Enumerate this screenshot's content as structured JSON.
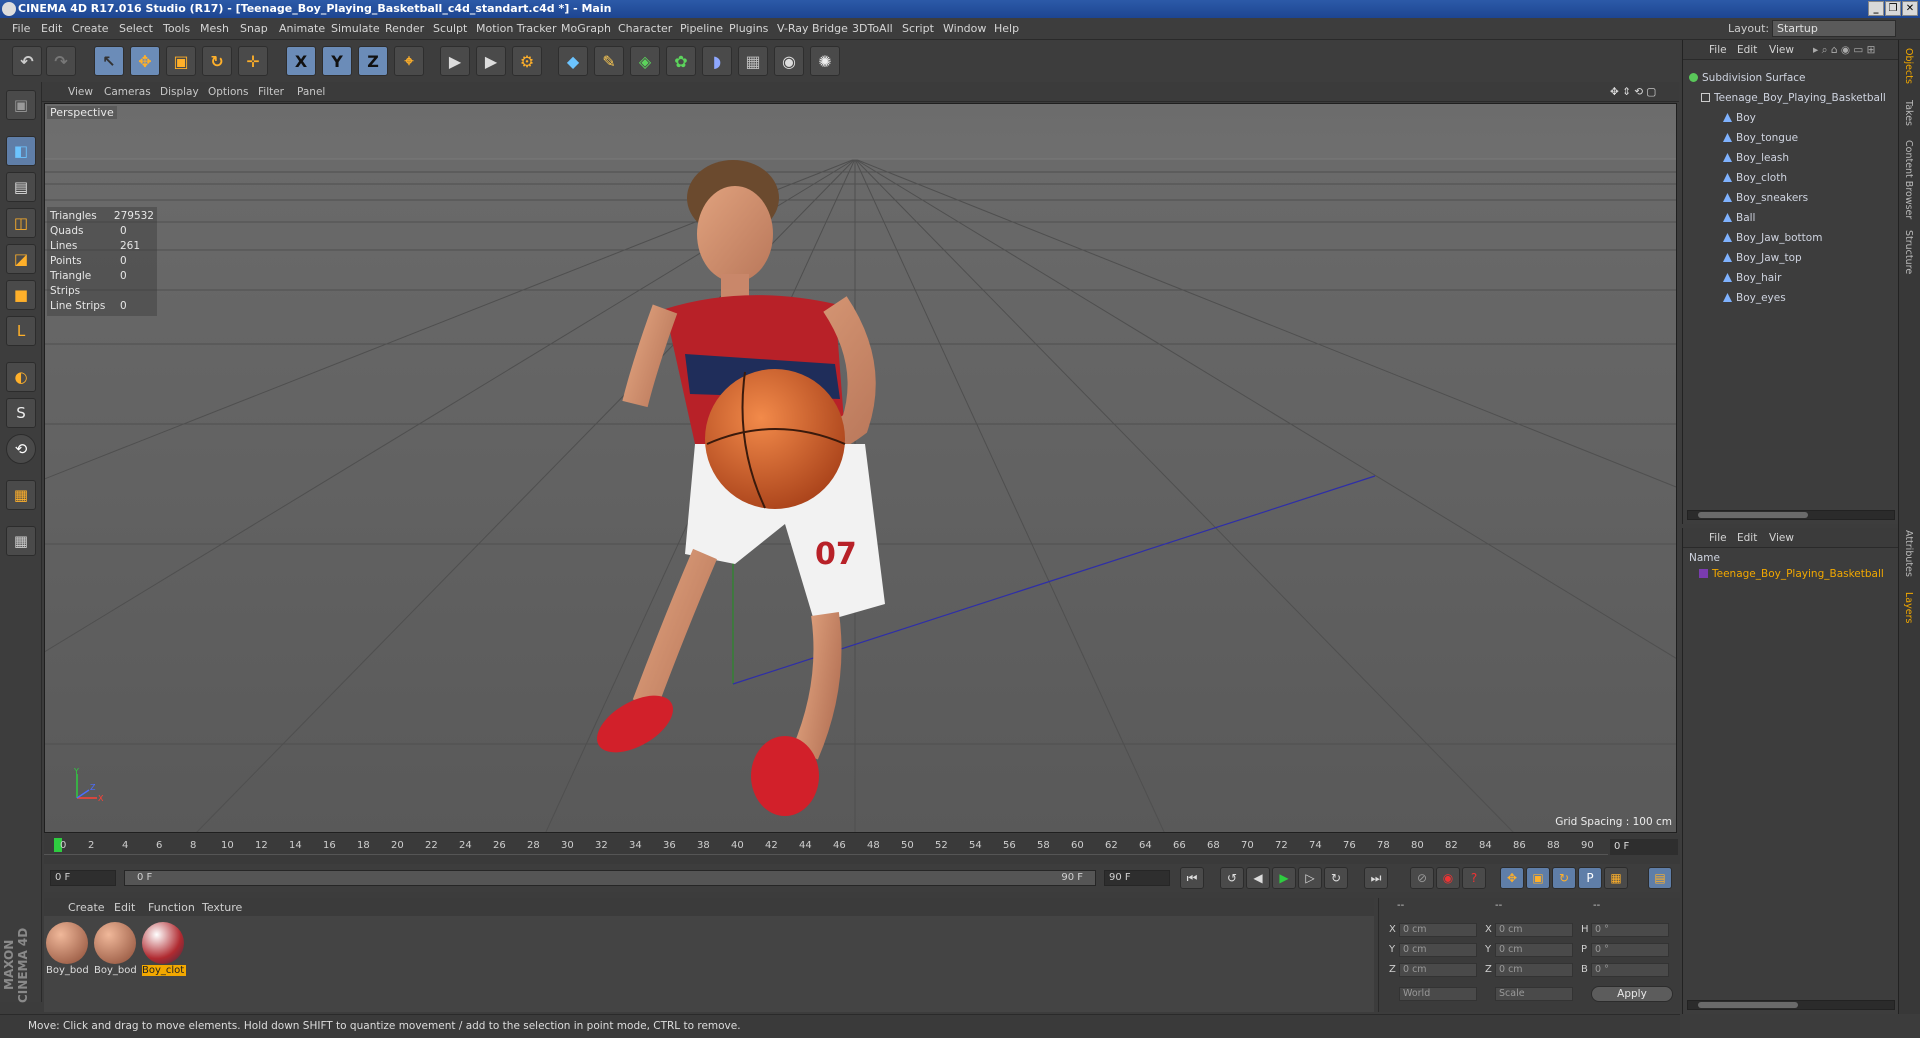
{
  "window": {
    "title": "CINEMA 4D R17.016 Studio (R17) - [Teenage_Boy_Playing_Basketball_c4d_standart.c4d *] - Main",
    "minimize": "_",
    "restore": "❐",
    "close": "✕"
  },
  "menubar": {
    "items": [
      "File",
      "Edit",
      "Create",
      "Select",
      "Tools",
      "Mesh",
      "Snap",
      "Animate",
      "Simulate",
      "Render",
      "Sculpt",
      "Motion Tracker",
      "MoGraph",
      "Character",
      "Pipeline",
      "Plugins",
      "V-Ray Bridge",
      "3DToAll",
      "Script",
      "Window",
      "Help"
    ],
    "layout_label": "Layout:",
    "layout_value": "Startup"
  },
  "toolbar": {
    "undo_icon": "↶",
    "redo_icon": "↷",
    "select_icon": "↖",
    "move_icon": "✥",
    "scale_icon": "▣",
    "rotate_icon": "↻",
    "transform_icon": "✛",
    "x_label": "X",
    "y_label": "Y",
    "z_label": "Z",
    "coord_icon": "⌖",
    "render_view_icon": "▶",
    "render_pic_icon": "▶",
    "render_settings_icon": "⚙",
    "cube_icon": "◆",
    "pen_icon": "✎",
    "subdiv_icon": "◈",
    "array_icon": "✿",
    "deform_icon": "◗",
    "floor_icon": "▦",
    "camera_icon": "◉",
    "light_icon": "✺"
  },
  "left_tools": [
    "▣",
    "◧",
    "▤",
    "◫",
    "◪",
    "■",
    "L",
    "◐",
    "S",
    "⟲",
    "▦",
    "▦"
  ],
  "viewport": {
    "menu": [
      "View",
      "Cameras",
      "Display",
      "Options",
      "Filter",
      "Panel"
    ],
    "camera_label": "Perspective",
    "grid_spacing": "Grid Spacing : 100 cm",
    "stats": [
      {
        "k": "Triangles",
        "v": "279532"
      },
      {
        "k": "Quads",
        "v": "0"
      },
      {
        "k": "Lines",
        "v": "261"
      },
      {
        "k": "Points",
        "v": "0"
      },
      {
        "k": "Triangle Strips",
        "v": "0"
      },
      {
        "k": "Line Strips",
        "v": "0"
      }
    ],
    "jersey_number": "07",
    "axis_y": "Y",
    "axis_x": "X",
    "axis_z": "Z"
  },
  "timeline": {
    "ticks": [
      "0",
      "2",
      "4",
      "6",
      "8",
      "10",
      "12",
      "14",
      "16",
      "18",
      "20",
      "22",
      "24",
      "26",
      "28",
      "30",
      "32",
      "34",
      "36",
      "38",
      "40",
      "42",
      "44",
      "46",
      "48",
      "50",
      "52",
      "54",
      "56",
      "58",
      "60",
      "62",
      "64",
      "66",
      "68",
      "70",
      "72",
      "74",
      "76",
      "78",
      "80",
      "82",
      "84",
      "86",
      "88",
      "90"
    ],
    "frame_end_display": "0 F"
  },
  "playback": {
    "start_field": "0 F",
    "range_start": "0 F",
    "range_end": "90 F",
    "end_field": "90 F"
  },
  "materials": {
    "menu": [
      "Create",
      "Edit",
      "Function",
      "Texture"
    ],
    "items": [
      {
        "label": "Boy_bod",
        "color": "#c98a6a"
      },
      {
        "label": "Boy_bod",
        "color": "#c98a6a"
      },
      {
        "label": "Boy_clot",
        "color": "#d8d8d8",
        "selected": true
      }
    ]
  },
  "coordinates": {
    "header": "--",
    "header2": "--",
    "header3": "--",
    "rows": [
      {
        "a": "X",
        "av": "0 cm",
        "b": "X",
        "bv": "0 cm",
        "c": "H",
        "cv": "0 °"
      },
      {
        "a": "Y",
        "av": "0 cm",
        "b": "Y",
        "bv": "0 cm",
        "c": "P",
        "cv": "0 °"
      },
      {
        "a": "Z",
        "av": "0 cm",
        "b": "Z",
        "bv": "0 cm",
        "c": "B",
        "cv": "0 °"
      }
    ],
    "mode": "World",
    "scale": "Scale",
    "apply": "Apply"
  },
  "status": "Move: Click and drag to move elements. Hold down SHIFT to quantize movement / add to the selection in point mode, CTRL to remove.",
  "logo": "MAXON CINEMA 4D",
  "objects": {
    "menu": [
      "File",
      "Edit",
      "View"
    ],
    "items": [
      {
        "name": "Subdivision Surface",
        "level": 0,
        "color": "#5ac85a"
      },
      {
        "name": "Teenage_Boy_Playing_Basketball",
        "level": 1,
        "color": "#cccccc"
      },
      {
        "name": "Boy",
        "level": 2,
        "color": "#7fb2ff"
      },
      {
        "name": "Boy_tongue",
        "level": 2,
        "color": "#7fb2ff"
      },
      {
        "name": "Boy_leash",
        "level": 2,
        "color": "#7fb2ff"
      },
      {
        "name": "Boy_cloth",
        "level": 2,
        "color": "#7fb2ff"
      },
      {
        "name": "Boy_sneakers",
        "level": 2,
        "color": "#7fb2ff"
      },
      {
        "name": "Ball",
        "level": 2,
        "color": "#7fb2ff"
      },
      {
        "name": "Boy_Jaw_bottom",
        "level": 2,
        "color": "#7fb2ff"
      },
      {
        "name": "Boy_Jaw_top",
        "level": 2,
        "color": "#7fb2ff"
      },
      {
        "name": "Boy_hair",
        "level": 2,
        "color": "#7fb2ff"
      },
      {
        "name": "Boy_eyes",
        "level": 2,
        "color": "#7fb2ff"
      }
    ]
  },
  "layers": {
    "menu": [
      "File",
      "Edit",
      "View"
    ],
    "name_header": "Name",
    "items": [
      {
        "name": "Teenage_Boy_Playing_Basketball"
      }
    ]
  },
  "side_tabs": [
    "Objects",
    "Takes",
    "Content Browser",
    "Structure",
    "Attributes",
    "Layers"
  ]
}
